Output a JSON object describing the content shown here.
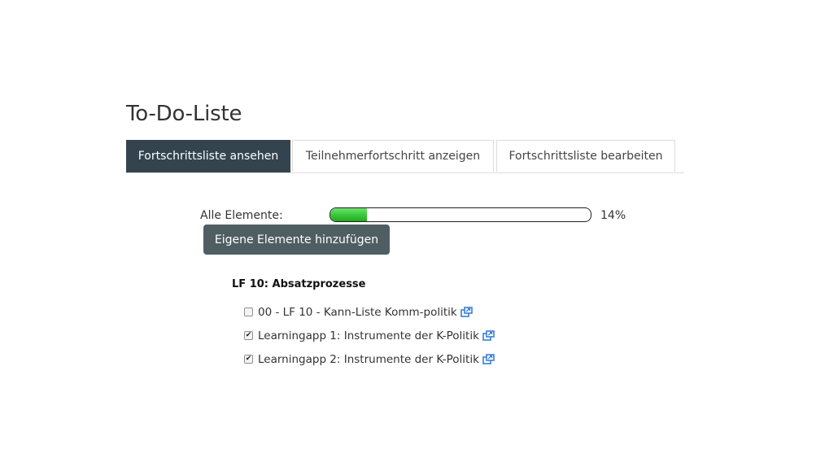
{
  "page": {
    "title": "To-Do-Liste"
  },
  "tabs": [
    {
      "label": "Fortschrittsliste ansehen",
      "active": true
    },
    {
      "label": "Teilnehmerfortschritt anzeigen",
      "active": false
    },
    {
      "label": "Fortschrittsliste bearbeiten",
      "active": false
    }
  ],
  "progress": {
    "label": "Alle Elemente:",
    "percent_text": "14%",
    "value": 0.14
  },
  "add_button_label": "Eigene Elemente hinzufügen",
  "section": {
    "heading": "LF 10: Absatzprozesse",
    "items": [
      {
        "label": "00 - LF 10 - Kann-Liste Komm-politik",
        "checked": false,
        "icon": "external-link-icon"
      },
      {
        "label": "Learningapp 1: Instrumente der K-Politik",
        "checked": true,
        "icon": "external-link-icon"
      },
      {
        "label": "Learningapp 2: Instrumente der K-Politik",
        "checked": true,
        "icon": "external-link-icon"
      }
    ]
  },
  "colors": {
    "tab_active_bg": "#34444f",
    "button_bg": "#4f5e63",
    "progress_fill": "#3fcc3f",
    "link_icon": "#3a7fd5"
  }
}
